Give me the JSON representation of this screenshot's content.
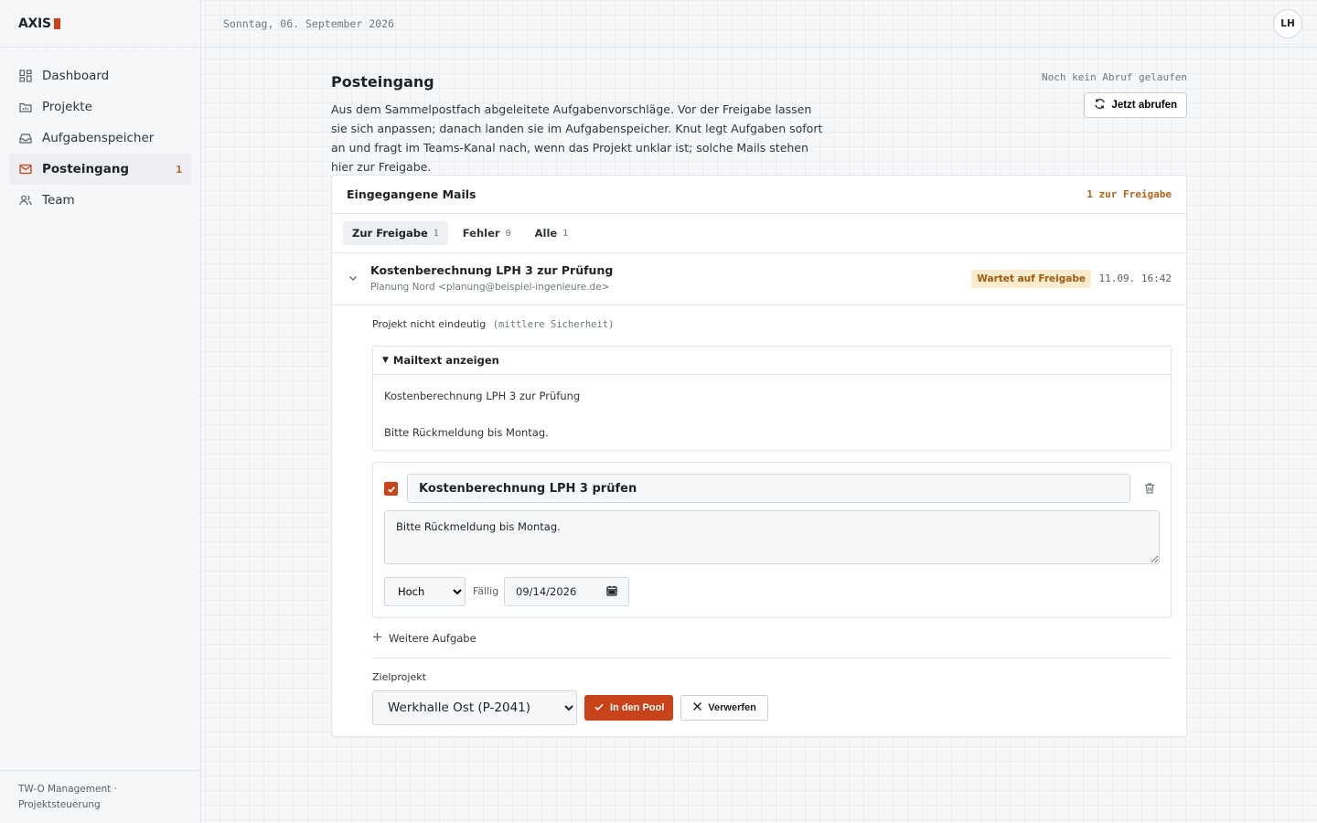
{
  "app": {
    "logo": "AXIS"
  },
  "topbar": {
    "date": "Sonntag, 06. September 2026",
    "avatar": "LH"
  },
  "sidebar": {
    "items": [
      {
        "label": "Dashboard",
        "icon": "grid-icon"
      },
      {
        "label": "Projekte",
        "icon": "folder-icon"
      },
      {
        "label": "Aufgabenspeicher",
        "icon": "inbox-tray-icon"
      },
      {
        "label": "Posteingang",
        "icon": "mail-icon",
        "badge": "1",
        "active": true
      },
      {
        "label": "Team",
        "icon": "users-icon"
      }
    ],
    "footer_line1": "TW-O Management ·",
    "footer_line2": "Projektsteuerung"
  },
  "page": {
    "title": "Posteingang",
    "description": "Aus dem Sammelpostfach abgeleitete Aufgabenvorschläge. Vor der Freigabe lassen sie sich anpassen; danach landen sie im Aufgabenspeicher. Knut legt Aufgaben sofort an und fragt im Teams-Kanal nach, wenn das Projekt unklar ist; solche Mails stehen hier zur Freigabe.",
    "fetch_status": "Noch kein Abruf gelaufen",
    "fetch_button": "Jetzt abrufen"
  },
  "mails_card": {
    "title": "Eingegangene Mails",
    "count_label": "1 zur Freigabe",
    "tabs": [
      {
        "label": "Zur Freigabe",
        "count": "1",
        "active": true
      },
      {
        "label": "Fehler",
        "count": "0"
      },
      {
        "label": "Alle",
        "count": "1"
      }
    ]
  },
  "mail": {
    "subject": "Kostenberechnung LPH 3 zur Prüfung",
    "from": "Planung Nord <planung@beispiel-ingenieure.de>",
    "status": "Wartet auf Freigabe",
    "time": "11.09. 16:42",
    "project_hint": "Projekt nicht eindeutig",
    "confidence": "(mittlere Sicherheit)",
    "mailtext_toggle": "Mailtext anzeigen",
    "body_line1": "Kostenberechnung LPH 3 zur Prüfung",
    "body_line2": "Bitte Rückmeldung bis Montag."
  },
  "task": {
    "checked": true,
    "title": "Kostenberechnung LPH 3 prüfen",
    "description": "Bitte Rückmeldung bis Montag.",
    "priority": "Hoch",
    "priority_options": [
      "Hoch"
    ],
    "due_label": "Fällig",
    "due_date": "09/14/2026"
  },
  "actions": {
    "add_task": "Weitere Aufgabe",
    "target_label": "Zielprojekt",
    "target_project": "Werkhalle Ost (P-2041)",
    "approve": "In den Pool",
    "reject": "Verwerfen"
  },
  "colors": {
    "accent": "#c8431a",
    "warning_bg": "#fbeccd",
    "warning_text": "#9a5a10"
  }
}
